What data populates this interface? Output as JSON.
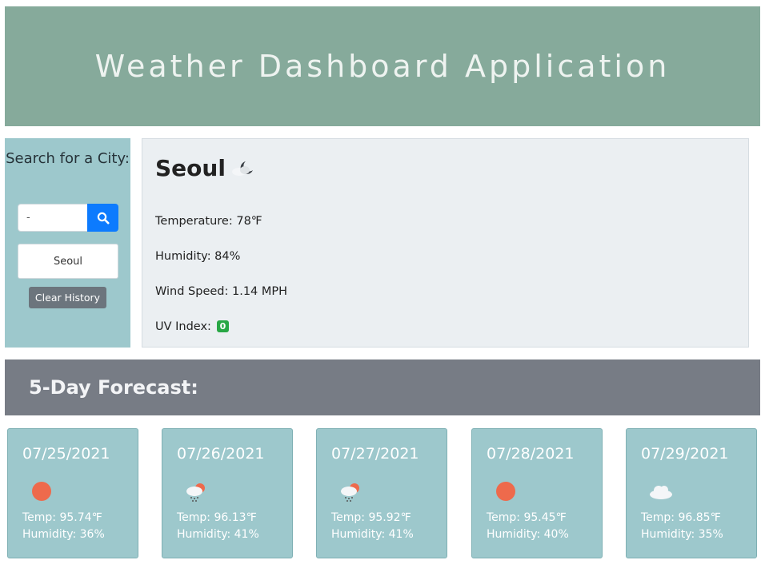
{
  "header": {
    "title": "Weather Dashboard Application"
  },
  "search": {
    "title": "Search for a City:",
    "input_value": "-",
    "history": [
      "Seoul"
    ],
    "clear_label": "Clear History",
    "search_icon": "search-icon"
  },
  "current": {
    "city": "Seoul",
    "icon": "cloud-moon-icon",
    "temperature": "Temperature: 78℉",
    "humidity": "Humidity: 84%",
    "wind": "Wind Speed: 1.14 MPH",
    "uv_label": "UV Index:",
    "uv_value": "0",
    "uv_color": "#28a745"
  },
  "forecast": {
    "title": "5-Day Forecast:",
    "days": [
      {
        "date": "07/25/2021",
        "icon": "sun-icon",
        "temp": "Temp: 95.74℉",
        "humidity": "Humidity: 36%"
      },
      {
        "date": "07/26/2021",
        "icon": "sun-rain-cloud-icon",
        "temp": "Temp: 96.13℉",
        "humidity": "Humidity: 41%"
      },
      {
        "date": "07/27/2021",
        "icon": "sun-rain-cloud-icon",
        "temp": "Temp: 95.92℉",
        "humidity": "Humidity: 41%"
      },
      {
        "date": "07/28/2021",
        "icon": "sun-icon",
        "temp": "Temp: 95.45℉",
        "humidity": "Humidity: 40%"
      },
      {
        "date": "07/29/2021",
        "icon": "cloud-icon",
        "temp": "Temp: 96.85℉",
        "humidity": "Humidity: 35%"
      }
    ]
  },
  "colors": {
    "header_bg": "#86aa9b",
    "panel_bg": "#9dc8cc",
    "forecast_bar_bg": "#777c85",
    "search_button": "#0d7bfe",
    "sun": "#ee6a4c"
  }
}
